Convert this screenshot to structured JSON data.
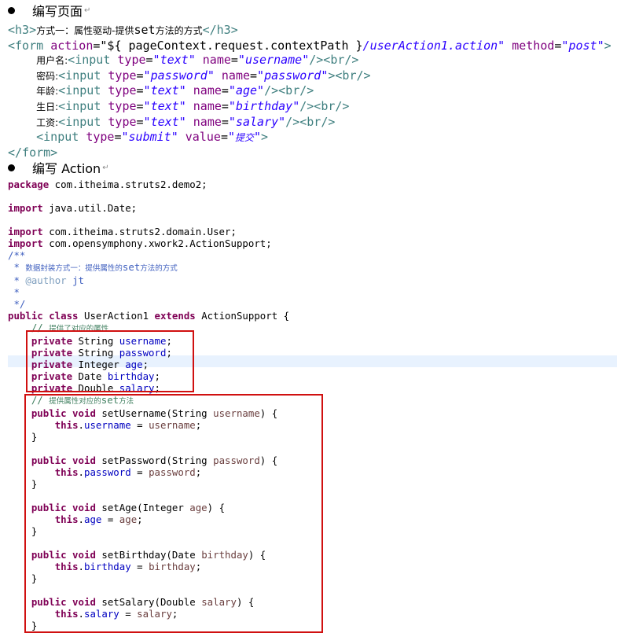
{
  "section1": {
    "title": "编写页面"
  },
  "html_lines": [
    [
      {
        "c": "tag",
        "t": "<h3>"
      },
      {
        "c": "cjk",
        "t": "方式一：属性驱动-提供"
      },
      {
        "c": "el",
        "t": "set"
      },
      {
        "c": "cjk",
        "t": "方法的方式"
      },
      {
        "c": "tag",
        "t": "</h3>"
      }
    ],
    [
      {
        "c": "tag",
        "t": "<form "
      },
      {
        "c": "attr",
        "t": "action"
      },
      {
        "c": "el",
        "t": "=\"${ pageContext.request.contextPath }"
      },
      {
        "c": "str",
        "t": "/userAction1.action\""
      },
      {
        "c": "el",
        "t": " "
      },
      {
        "c": "attr",
        "t": "method"
      },
      {
        "c": "el",
        "t": "="
      },
      {
        "c": "str",
        "t": "\"post\""
      },
      {
        "c": "tag",
        "t": ">"
      }
    ],
    [
      {
        "c": "el",
        "t": "    "
      },
      {
        "c": "cjk",
        "t": "用户名:"
      },
      {
        "c": "tag",
        "t": "<input "
      },
      {
        "c": "attr",
        "t": "type"
      },
      {
        "c": "el",
        "t": "="
      },
      {
        "c": "str",
        "t": "\"text\""
      },
      {
        "c": "el",
        "t": " "
      },
      {
        "c": "attr",
        "t": "name"
      },
      {
        "c": "el",
        "t": "="
      },
      {
        "c": "str",
        "t": "\"username\""
      },
      {
        "c": "tag",
        "t": "/><br/>"
      }
    ],
    [
      {
        "c": "el",
        "t": "    "
      },
      {
        "c": "cjk",
        "t": "密码:"
      },
      {
        "c": "tag",
        "t": "<input "
      },
      {
        "c": "attr",
        "t": "type"
      },
      {
        "c": "el",
        "t": "="
      },
      {
        "c": "str",
        "t": "\"password\""
      },
      {
        "c": "el",
        "t": " "
      },
      {
        "c": "attr",
        "t": "name"
      },
      {
        "c": "el",
        "t": "="
      },
      {
        "c": "str",
        "t": "\"password\""
      },
      {
        "c": "tag",
        "t": "><br/>"
      }
    ],
    [
      {
        "c": "el",
        "t": "    "
      },
      {
        "c": "cjk",
        "t": "年龄:"
      },
      {
        "c": "tag",
        "t": "<input "
      },
      {
        "c": "attr",
        "t": "type"
      },
      {
        "c": "el",
        "t": "="
      },
      {
        "c": "str",
        "t": "\"text\""
      },
      {
        "c": "el",
        "t": " "
      },
      {
        "c": "attr",
        "t": "name"
      },
      {
        "c": "el",
        "t": "="
      },
      {
        "c": "str",
        "t": "\"age\""
      },
      {
        "c": "tag",
        "t": "/><br/>"
      }
    ],
    [
      {
        "c": "el",
        "t": "    "
      },
      {
        "c": "cjk",
        "t": "生日:"
      },
      {
        "c": "tag",
        "t": "<input "
      },
      {
        "c": "attr",
        "t": "type"
      },
      {
        "c": "el",
        "t": "="
      },
      {
        "c": "str",
        "t": "\"text\""
      },
      {
        "c": "el",
        "t": " "
      },
      {
        "c": "attr",
        "t": "name"
      },
      {
        "c": "el",
        "t": "="
      },
      {
        "c": "str",
        "t": "\"birthday\""
      },
      {
        "c": "tag",
        "t": "/><br/>"
      }
    ],
    [
      {
        "c": "el",
        "t": "    "
      },
      {
        "c": "cjk",
        "t": "工资:"
      },
      {
        "c": "tag",
        "t": "<input "
      },
      {
        "c": "attr",
        "t": "type"
      },
      {
        "c": "el",
        "t": "="
      },
      {
        "c": "str",
        "t": "\"text\""
      },
      {
        "c": "el",
        "t": " "
      },
      {
        "c": "attr",
        "t": "name"
      },
      {
        "c": "el",
        "t": "="
      },
      {
        "c": "str",
        "t": "\"salary\""
      },
      {
        "c": "tag",
        "t": "/><br/>"
      }
    ],
    [
      {
        "c": "el",
        "t": "    "
      },
      {
        "c": "tag",
        "t": "<input "
      },
      {
        "c": "attr",
        "t": "type"
      },
      {
        "c": "el",
        "t": "="
      },
      {
        "c": "str",
        "t": "\"submit\""
      },
      {
        "c": "el",
        "t": " "
      },
      {
        "c": "attr",
        "t": "value"
      },
      {
        "c": "el",
        "t": "="
      },
      {
        "c": "str",
        "t": "\""
      },
      {
        "c": "cjk-i",
        "t": "提交"
      },
      {
        "c": "str",
        "t": "\""
      },
      {
        "c": "tag",
        "t": ">"
      }
    ],
    [
      {
        "c": "tag",
        "t": "</form>"
      }
    ]
  ],
  "section2": {
    "title": "编写 Action"
  },
  "java_lines": [
    [
      {
        "c": "kw",
        "t": "package"
      },
      {
        "c": "el",
        "t": " com.itheima.struts2.demo2;"
      }
    ],
    [],
    [
      {
        "c": "kw",
        "t": "import"
      },
      {
        "c": "el",
        "t": " java.util.Date;"
      }
    ],
    [],
    [
      {
        "c": "kw",
        "t": "import"
      },
      {
        "c": "el",
        "t": " com.itheima.struts2.domain.User;"
      }
    ],
    [
      {
        "c": "kw",
        "t": "import"
      },
      {
        "c": "el",
        "t": " com.opensymphony.xwork2.ActionSupport;"
      }
    ],
    [
      {
        "c": "jdoc",
        "t": "/**"
      }
    ],
    [
      {
        "c": "jdoc",
        "t": " * "
      },
      {
        "c": "jdoc small-cjk",
        "t": "数据封装方式一：提供属性的"
      },
      {
        "c": "jdoc",
        "t": "set"
      },
      {
        "c": "jdoc small-cjk",
        "t": "方法的方式"
      }
    ],
    [
      {
        "c": "jdoc",
        "t": " * "
      },
      {
        "c": "jtag",
        "t": "@author"
      },
      {
        "c": "jdoc",
        "t": " jt"
      }
    ],
    [
      {
        "c": "jdoc",
        "t": " *"
      }
    ],
    [
      {
        "c": "jdoc",
        "t": " */"
      }
    ],
    [
      {
        "c": "kw",
        "t": "public class"
      },
      {
        "c": "el",
        "t": " UserAction1 "
      },
      {
        "c": "kw",
        "t": "extends"
      },
      {
        "c": "el",
        "t": " ActionSupport {"
      }
    ],
    [
      {
        "c": "el",
        "t": "    "
      },
      {
        "c": "cmt",
        "t": "// "
      },
      {
        "c": "cmt small-cjk",
        "t": "提供了对应的属性"
      }
    ],
    [
      {
        "c": "el",
        "t": "    "
      },
      {
        "c": "kw",
        "t": "private"
      },
      {
        "c": "el",
        "t": " String "
      },
      {
        "c": "fld",
        "t": "username"
      },
      {
        "c": "el",
        "t": ";"
      }
    ],
    [
      {
        "c": "el",
        "t": "    "
      },
      {
        "c": "kw",
        "t": "private"
      },
      {
        "c": "el",
        "t": " String "
      },
      {
        "c": "fld",
        "t": "password"
      },
      {
        "c": "el",
        "t": ";"
      }
    ],
    [
      {
        "c": "el",
        "t": "    "
      },
      {
        "c": "kw",
        "t": "private"
      },
      {
        "c": "el",
        "t": " Integer "
      },
      {
        "c": "fld",
        "t": "age"
      },
      {
        "c": "el",
        "t": ";"
      }
    ],
    [
      {
        "c": "el",
        "t": "    "
      },
      {
        "c": "kw",
        "t": "private"
      },
      {
        "c": "el",
        "t": " Date "
      },
      {
        "c": "fld",
        "t": "birthday"
      },
      {
        "c": "el",
        "t": ";"
      }
    ],
    [
      {
        "c": "el",
        "t": "    "
      },
      {
        "c": "kw",
        "t": "private"
      },
      {
        "c": "el",
        "t": " Double "
      },
      {
        "c": "fld",
        "t": "salary"
      },
      {
        "c": "el",
        "t": ";"
      }
    ],
    [
      {
        "c": "el",
        "t": "    "
      },
      {
        "c": "cmt",
        "t": "// "
      },
      {
        "c": "cmt small-cjk",
        "t": "提供属性对应的"
      },
      {
        "c": "cmt",
        "t": "set"
      },
      {
        "c": "cmt small-cjk",
        "t": "方法"
      }
    ],
    [
      {
        "c": "el",
        "t": "    "
      },
      {
        "c": "kw",
        "t": "public void"
      },
      {
        "c": "el",
        "t": " setUsername(String "
      },
      {
        "c": "param",
        "t": "username"
      },
      {
        "c": "el",
        "t": ") {"
      }
    ],
    [
      {
        "c": "el",
        "t": "        "
      },
      {
        "c": "kw",
        "t": "this"
      },
      {
        "c": "el",
        "t": "."
      },
      {
        "c": "fld",
        "t": "username"
      },
      {
        "c": "el",
        "t": " = "
      },
      {
        "c": "param",
        "t": "username"
      },
      {
        "c": "el",
        "t": ";"
      }
    ],
    [
      {
        "c": "el",
        "t": "    }"
      }
    ],
    [],
    [
      {
        "c": "el",
        "t": "    "
      },
      {
        "c": "kw",
        "t": "public void"
      },
      {
        "c": "el",
        "t": " setPassword(String "
      },
      {
        "c": "param",
        "t": "password"
      },
      {
        "c": "el",
        "t": ") {"
      }
    ],
    [
      {
        "c": "el",
        "t": "        "
      },
      {
        "c": "kw",
        "t": "this"
      },
      {
        "c": "el",
        "t": "."
      },
      {
        "c": "fld",
        "t": "password"
      },
      {
        "c": "el",
        "t": " = "
      },
      {
        "c": "param",
        "t": "password"
      },
      {
        "c": "el",
        "t": ";"
      }
    ],
    [
      {
        "c": "el",
        "t": "    }"
      }
    ],
    [],
    [
      {
        "c": "el",
        "t": "    "
      },
      {
        "c": "kw",
        "t": "public void"
      },
      {
        "c": "el",
        "t": " setAge(Integer "
      },
      {
        "c": "param",
        "t": "age"
      },
      {
        "c": "el",
        "t": ") {"
      }
    ],
    [
      {
        "c": "el",
        "t": "        "
      },
      {
        "c": "kw",
        "t": "this"
      },
      {
        "c": "el",
        "t": "."
      },
      {
        "c": "fld",
        "t": "age"
      },
      {
        "c": "el",
        "t": " = "
      },
      {
        "c": "param",
        "t": "age"
      },
      {
        "c": "el",
        "t": ";"
      }
    ],
    [
      {
        "c": "el",
        "t": "    }"
      }
    ],
    [],
    [
      {
        "c": "el",
        "t": "    "
      },
      {
        "c": "kw",
        "t": "public void"
      },
      {
        "c": "el",
        "t": " setBirthday(Date "
      },
      {
        "c": "param",
        "t": "birthday"
      },
      {
        "c": "el",
        "t": ") {"
      }
    ],
    [
      {
        "c": "el",
        "t": "        "
      },
      {
        "c": "kw",
        "t": "this"
      },
      {
        "c": "el",
        "t": "."
      },
      {
        "c": "fld",
        "t": "birthday"
      },
      {
        "c": "el",
        "t": " = "
      },
      {
        "c": "param",
        "t": "birthday"
      },
      {
        "c": "el",
        "t": ";"
      }
    ],
    [
      {
        "c": "el",
        "t": "    }"
      }
    ],
    [],
    [
      {
        "c": "el",
        "t": "    "
      },
      {
        "c": "kw",
        "t": "public void"
      },
      {
        "c": "el",
        "t": " setSalary(Double "
      },
      {
        "c": "param",
        "t": "salary"
      },
      {
        "c": "el",
        "t": ") {"
      }
    ],
    [
      {
        "c": "el",
        "t": "        "
      },
      {
        "c": "kw",
        "t": "this"
      },
      {
        "c": "el",
        "t": "."
      },
      {
        "c": "fld",
        "t": "salary"
      },
      {
        "c": "el",
        "t": " = "
      },
      {
        "c": "param",
        "t": "salary"
      },
      {
        "c": "el",
        "t": ";"
      }
    ],
    [
      {
        "c": "el",
        "t": "    }"
      }
    ]
  ]
}
